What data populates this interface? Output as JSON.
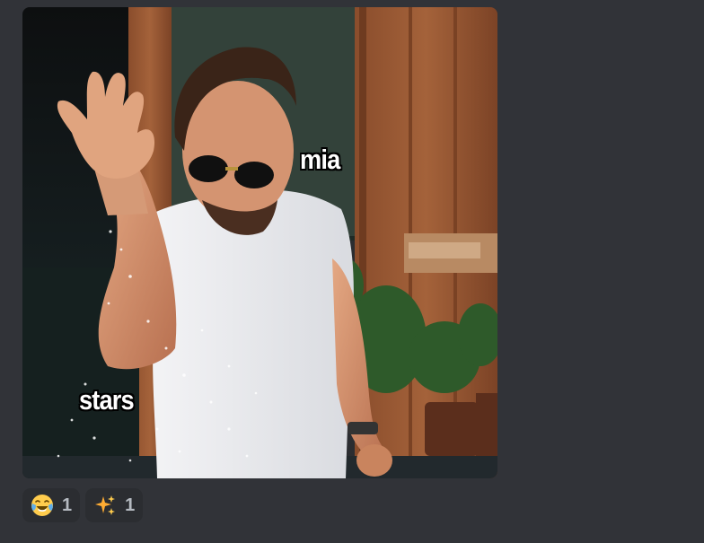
{
  "message": {
    "attachment": {
      "caption_top": "mia",
      "caption_bottom": "stars"
    },
    "reactions": [
      {
        "emoji": "face-with-tears-of-joy-icon",
        "count": "1"
      },
      {
        "emoji": "sparkles-icon",
        "count": "1"
      }
    ]
  },
  "colors": {
    "background": "#313338",
    "reaction_bg": "#2b2d31",
    "reaction_count": "#b5bac1"
  }
}
